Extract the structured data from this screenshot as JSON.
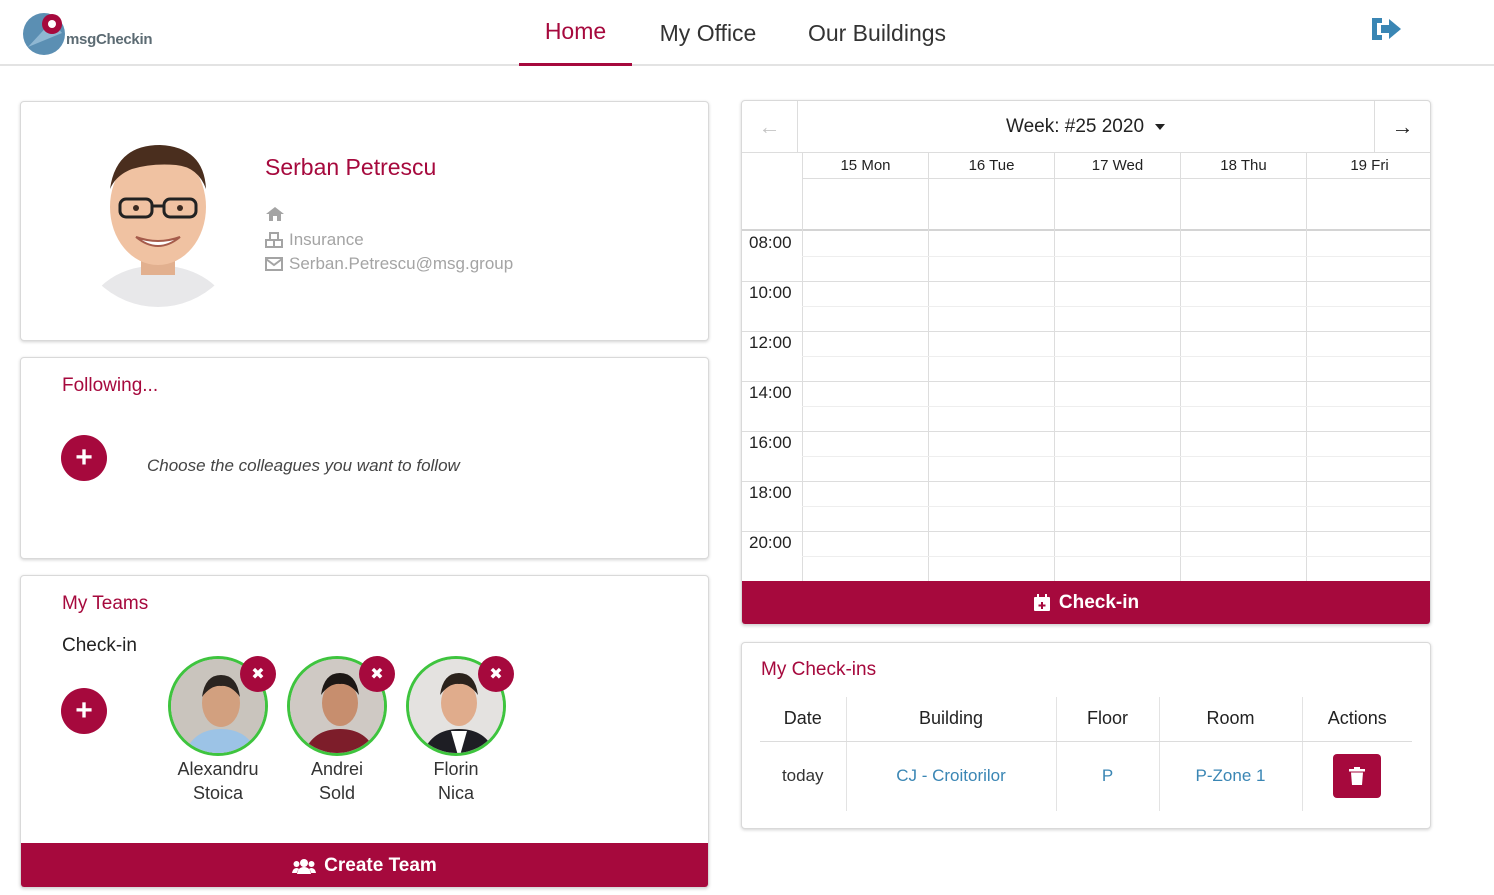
{
  "app": {
    "logo_text": "msgCheckin",
    "accent_color": "#a6093d",
    "link_color": "#3a86b4"
  },
  "nav": {
    "items": [
      {
        "label": "Home",
        "active": true
      },
      {
        "label": "My Office",
        "active": false
      },
      {
        "label": "Our Buildings",
        "active": false
      }
    ],
    "logout_icon": "sign-out-icon"
  },
  "profile": {
    "name": "Serban Petrescu",
    "location_icon": "home-icon",
    "department": "Insurance",
    "email": "Serban.Petrescu@msg.group"
  },
  "following": {
    "title": "Following...",
    "hint": "Choose the colleagues you want to follow"
  },
  "teams": {
    "title": "My Teams",
    "team_name": "Check-in",
    "members": [
      {
        "first": "Alexandru",
        "last": "Stoica"
      },
      {
        "first": "Andrei",
        "last": "Sold"
      },
      {
        "first": "Florin",
        "last": "Nica"
      }
    ],
    "create_label": "Create Team"
  },
  "calendar": {
    "week_label": "Week: #25 2020",
    "days": [
      "15 Mon",
      "16 Tue",
      "17 Wed",
      "18 Thu",
      "19 Fri"
    ],
    "times": [
      "08:00",
      "10:00",
      "12:00",
      "14:00",
      "16:00",
      "18:00",
      "20:00"
    ],
    "checkin_label": "Check-in"
  },
  "checkins": {
    "title": "My Check-ins",
    "columns": [
      "Date",
      "Building",
      "Floor",
      "Room",
      "Actions"
    ],
    "rows": [
      {
        "date": "today",
        "building": "CJ - Croitorilor",
        "floor": "P",
        "room": "P-Zone 1"
      }
    ]
  }
}
